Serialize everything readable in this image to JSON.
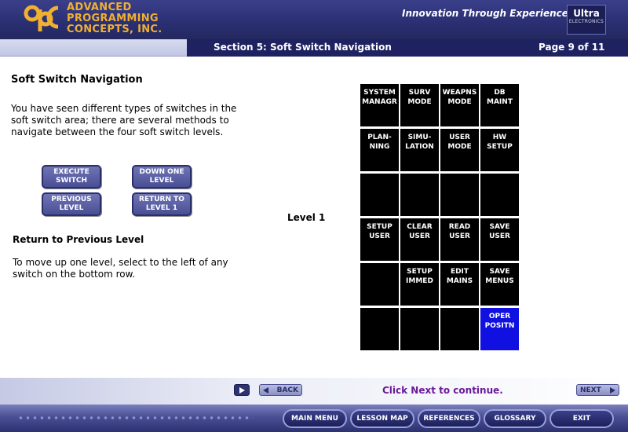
{
  "header": {
    "logo_lines": [
      "ADVANCED",
      "PROGRAMMING",
      "CONCEPTS, INC."
    ],
    "tagline": "Innovation Through Experience",
    "badge_title": "Ultra",
    "badge_sub": "ELECTRONICS"
  },
  "section": {
    "title": "Section 5: Soft Switch Navigation",
    "page": "Page 9 of 11"
  },
  "content": {
    "title": "Soft Switch Navigation",
    "intro": "You have seen different types of switches in the soft switch area; there are several methods to navigate between the four soft switch levels.",
    "buttons": {
      "execute": "EXECUTE\nSWITCH",
      "down": "DOWN ONE\nLEVEL",
      "previous": "PREVIOUS\nLEVEL",
      "return": "RETURN TO\nLEVEL 1"
    },
    "subtitle": "Return to Previous Level",
    "body": "To move up one level, select to the left of any switch on the bottom row.",
    "level_label": "Level 1"
  },
  "grid": {
    "cells": [
      "SYSTEM\nMANAGR",
      "SURV\nMODE",
      "WEAPNS\nMODE",
      "DB\nMAINT",
      "PLAN-\nNING",
      "SIMU-\nLATION",
      "USER\nMODE",
      "HW\nSETUP",
      "",
      "",
      "",
      "",
      "SETUP\nUSER",
      "CLEAR\nUSER",
      "READ\nUSER",
      "SAVE\nUSER",
      "",
      "SETUP\nIMMED",
      "EDIT\nMAINS",
      "SAVE\nMENUS",
      "",
      "",
      "",
      "OPER\nPOSITN"
    ],
    "active_index": 23,
    "active_color": "#1010e0"
  },
  "footer": {
    "back_label": "BACK",
    "continue_text": "Click Next to continue.",
    "next_label": "NEXT"
  },
  "menu": {
    "main_menu": "MAIN MENU",
    "lesson_map": "LESSON MAP",
    "references": "REFERENCES",
    "glossary": "GLOSSARY",
    "exit": "EXIT"
  }
}
